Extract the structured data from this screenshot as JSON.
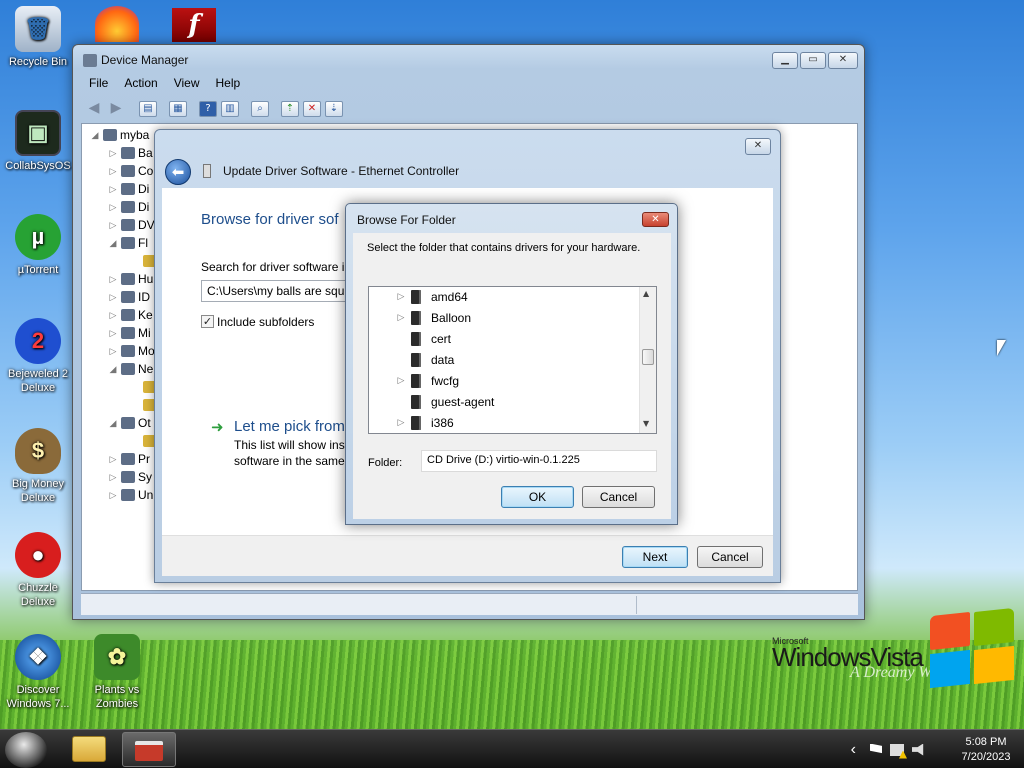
{
  "desktop": {
    "icons": [
      {
        "label": "Recycle Bin",
        "glyph": "🗑"
      },
      {
        "label": "CollabSysOS",
        "glyph": "▣"
      },
      {
        "label": "µTorrent",
        "glyph": "µ"
      },
      {
        "label": "Bejeweled 2 Deluxe",
        "glyph": "2"
      },
      {
        "label": "Big Money Deluxe",
        "glyph": "$"
      },
      {
        "label": "Chuzzle Deluxe",
        "glyph": "●"
      },
      {
        "label": "Discover Windows 7...",
        "glyph": "❖"
      },
      {
        "label": "Plants vs Zombies",
        "glyph": "✿"
      }
    ],
    "branding": {
      "small": "Microsoft",
      "big": "WindowsVista",
      "sub": "A Dreamy World"
    }
  },
  "device_manager": {
    "title": "Device Manager",
    "menu": [
      "File",
      "Action",
      "View",
      "Help"
    ],
    "tree": {
      "root": "myba",
      "items": [
        "Ba",
        "Co",
        "Di",
        "Di",
        "DV",
        "Fl",
        "",
        "Hu",
        "ID",
        "Ke",
        "Mi",
        "Mo",
        "Ne",
        "",
        "",
        "Ot",
        "",
        "Pr",
        "Sy",
        "Un"
      ]
    }
  },
  "wizard": {
    "title": "Update Driver Software - Ethernet Controller",
    "heading": "Browse for driver sof",
    "search_label": "Search for driver software i",
    "path_value": "C:\\Users\\my balls are squis",
    "include_subfolders": "Include subfolders",
    "pick_heading": "Let me pick from",
    "pick_desc_1": "This list will show inst",
    "pick_desc_2": "software in the same",
    "next": "Next",
    "cancel": "Cancel"
  },
  "browse_dialog": {
    "title": "Browse For Folder",
    "instruction": "Select the folder that contains drivers for your hardware.",
    "folders": [
      {
        "name": "amd64",
        "expandable": true
      },
      {
        "name": "Balloon",
        "expandable": true
      },
      {
        "name": "cert",
        "expandable": false
      },
      {
        "name": "data",
        "expandable": false
      },
      {
        "name": "fwcfg",
        "expandable": true
      },
      {
        "name": "guest-agent",
        "expandable": false
      },
      {
        "name": "i386",
        "expandable": true
      }
    ],
    "folder_label": "Folder:",
    "folder_value": "CD Drive (D:) virtio-win-0.1.225",
    "ok": "OK",
    "cancel": "Cancel"
  },
  "taskbar": {
    "time": "5:08 PM",
    "date": "7/20/2023",
    "chevron": "‹"
  },
  "colors": {
    "accent": "#3c7fb1",
    "heading_blue": "#1e4e8c",
    "close_red": "#c7422f"
  }
}
